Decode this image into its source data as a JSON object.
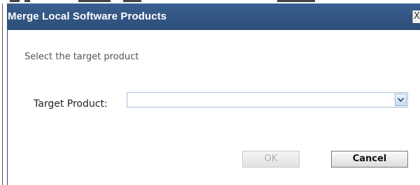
{
  "dialog": {
    "title": "Merge Local Software Products",
    "close_label": "X",
    "instruction": "Select the target product",
    "target_product": {
      "label": "Target Product:",
      "value": ""
    },
    "buttons": {
      "ok_label": "OK",
      "ok_enabled": false,
      "cancel_label": "Cancel"
    }
  },
  "colors": {
    "titlebar": "#2f5381",
    "title_text": "#ffffff",
    "select_border": "#a9c0d9",
    "disabled_text": "#b0b0b0"
  },
  "icons": {
    "close": "close-icon",
    "dropdown": "chevron-down-icon"
  }
}
